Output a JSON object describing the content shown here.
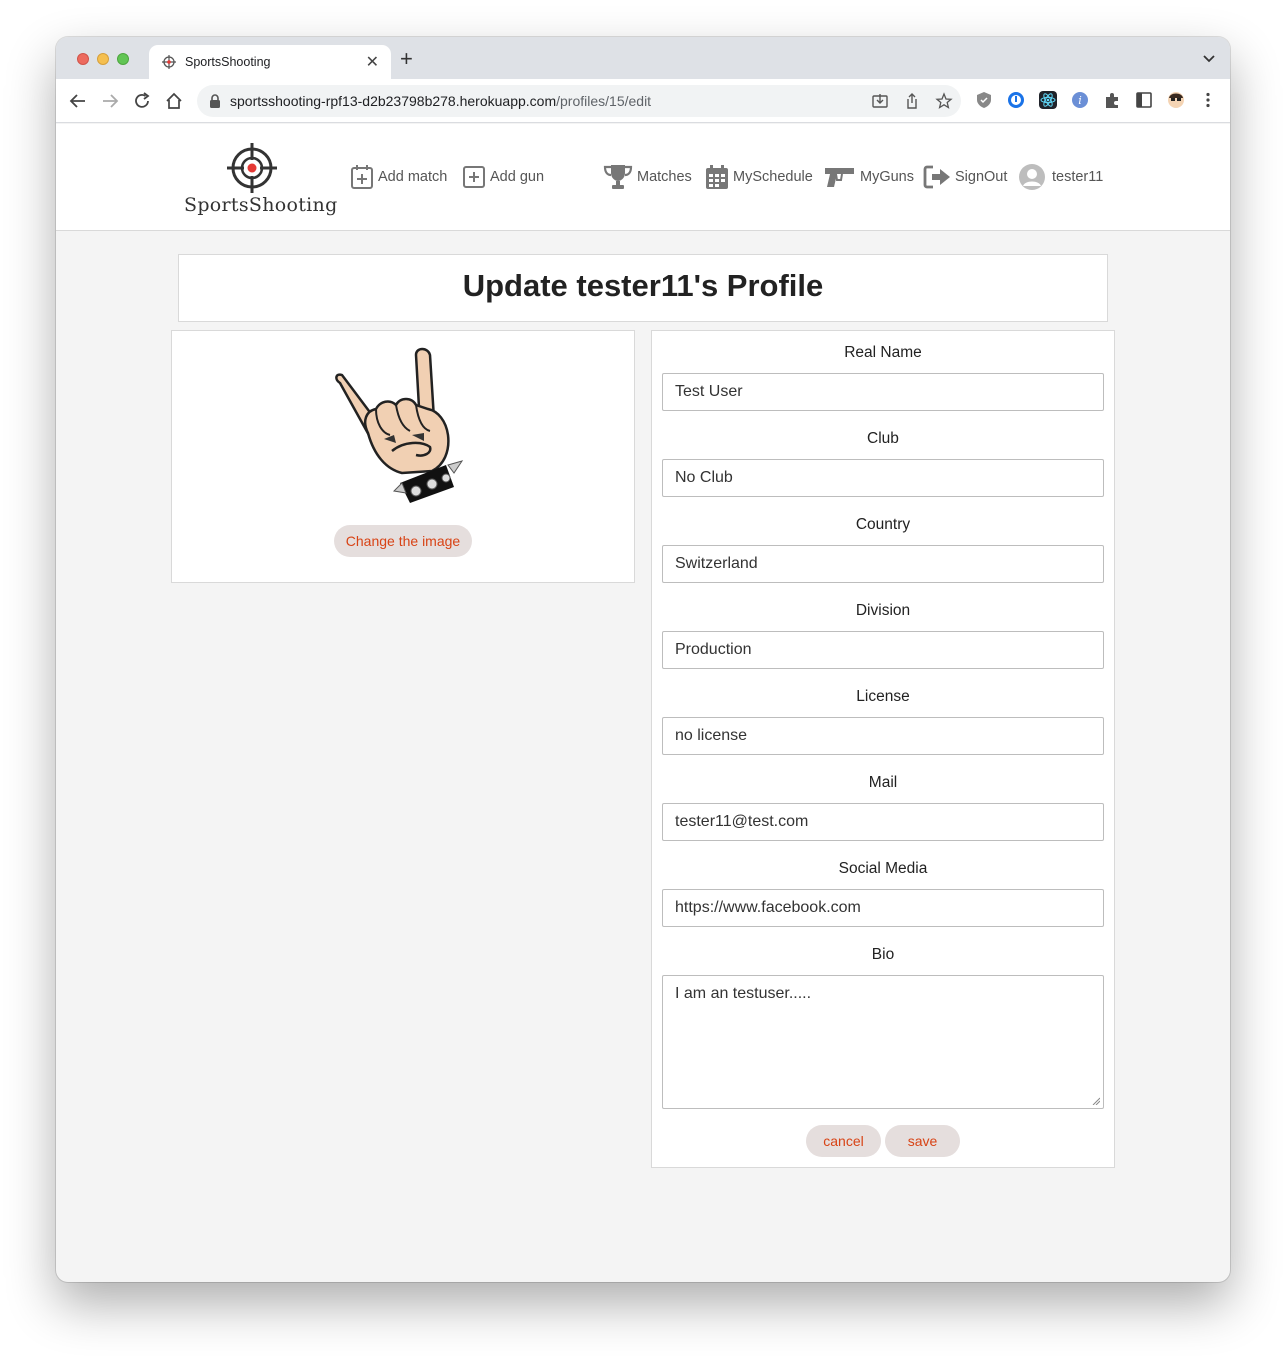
{
  "browser": {
    "tab_title": "SportsShooting",
    "url_host": "sportsshooting-rpf13-d2b23798b278.herokuapp.com",
    "url_path": "/profiles/15/edit"
  },
  "site": {
    "logo_text": "SportsShooting",
    "nav": {
      "add_match": "Add match",
      "add_gun": "Add gun",
      "matches": "Matches",
      "my_schedule": "MySchedule",
      "my_guns": "MyGuns",
      "sign_out": "SignOut",
      "username": "tester11"
    }
  },
  "page": {
    "title": "Update tester11's Profile",
    "change_image_label": "Change the image"
  },
  "form": {
    "real_name": {
      "label": "Real Name",
      "value": "Test User"
    },
    "club": {
      "label": "Club",
      "value": "No Club"
    },
    "country": {
      "label": "Country",
      "value": "Switzerland"
    },
    "division": {
      "label": "Division",
      "value": "Production"
    },
    "license": {
      "label": "License",
      "value": "no license"
    },
    "mail": {
      "label": "Mail",
      "value": "tester11@test.com"
    },
    "social_media": {
      "label": "Social Media",
      "value": "https://www.facebook.com"
    },
    "bio": {
      "label": "Bio",
      "value": "I am an testuser....."
    },
    "cancel_label": "cancel",
    "save_label": "save"
  },
  "colors": {
    "accent": "#d84315",
    "pill_bg": "#e5dedd",
    "page_bg": "#f4f4f4"
  }
}
